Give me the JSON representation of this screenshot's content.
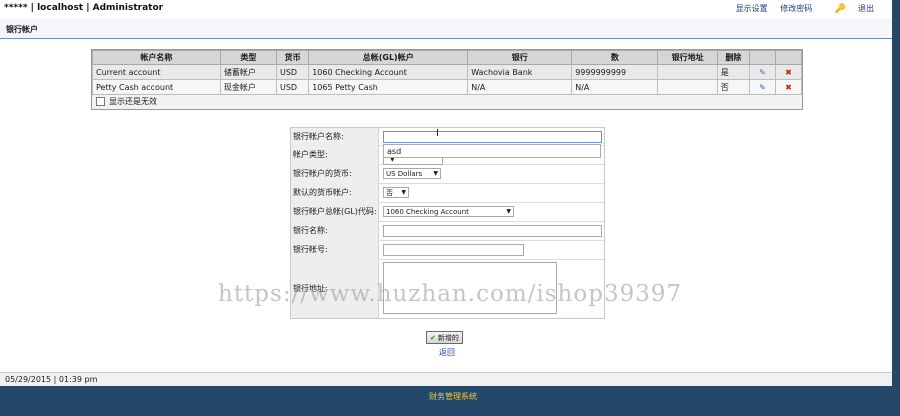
{
  "header": {
    "brand": "***** | localhost | Administrator",
    "links": [
      "显示设置",
      "修改密码",
      "退出"
    ]
  },
  "title": "银行帐户",
  "accounts_table": {
    "columns": [
      "帐户名称",
      "类型",
      "货币",
      "总帐(GL)帐户",
      "银行",
      "数",
      "银行地址",
      "删除"
    ],
    "rows": [
      {
        "name": "Current account",
        "type": "储蓄帐户",
        "currency": "USD",
        "gl": "1060 Checking Account",
        "bank": "Wachovia Bank",
        "number": "9999999999",
        "address": "",
        "inactive": "是"
      },
      {
        "name": "Petty Cash account",
        "type": "现金帐户",
        "currency": "USD",
        "gl": "1065 Petty Cash",
        "bank": "N/A",
        "number": "N/A",
        "address": "",
        "inactive": "否"
      }
    ],
    "show_inactive_label": "显示还是无效"
  },
  "form": {
    "labels": {
      "account_name": "银行帐户名称:",
      "account_type": "帐户类型:",
      "currency": "银行帐户的货币:",
      "default_currency": "默认的货币帐户:",
      "gl_code": "银行帐户总帐(GL)代码:",
      "bank_name": "银行名称:",
      "bank_number": "银行帐号:",
      "bank_address": "银行地址:"
    },
    "values": {
      "account_name": "",
      "autocomplete": "asd",
      "currency": "US Dollars",
      "default_currency": "否",
      "gl_code": "1060    Checking Account",
      "bank_name": "",
      "bank_number": "",
      "bank_address": ""
    },
    "submit_label": "新增的",
    "back_label": "返回"
  },
  "status_bar": "05/29/2015 | 01:39 pm",
  "footer": "财务管理系统",
  "watermark": "https://www.huzhan.com/ishop39397"
}
